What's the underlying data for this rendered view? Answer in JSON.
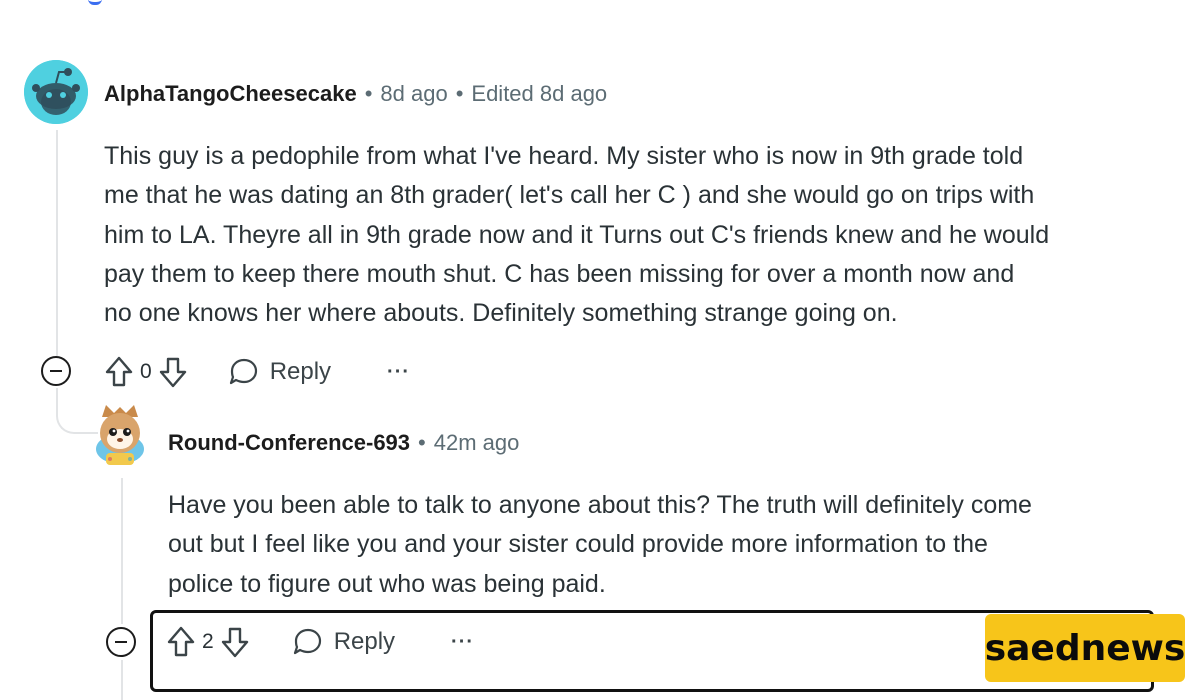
{
  "comment1": {
    "username": "AlphaTangoCheesecake",
    "time": "8d ago",
    "edited": "Edited 8d ago",
    "body_lines": [
      "This guy is a pedophile from what I've heard. My sister who is now in 9th grade told",
      "me that he was dating an 8th grader( let's call her C ) and she would go on trips with",
      "him to LA. Theyre all in 9th grade now and it Turns out C's friends knew and he would",
      "pay them to keep there mouth shut. C has been missing for over a month now and",
      "no one knows her where abouts. Definitely something strange going on."
    ],
    "votes": "0",
    "reply_label": "Reply",
    "more_label": "···"
  },
  "comment2": {
    "username": "Round-Conference-693",
    "time": "42m ago",
    "body_lines": [
      "Have you been able to talk to anyone about this? The truth will definitely come",
      "out but I feel like you and your sister could provide more information to the",
      "police to figure out who was being paid."
    ],
    "votes": "2",
    "reply_label": "Reply",
    "more_label": "···"
  },
  "watermark": {
    "text": "saednews"
  },
  "icons": {
    "upvote": "upvote-arrow-icon",
    "downvote": "downvote-arrow-icon",
    "reply": "speech-bubble-icon",
    "collapse": "minus-circle-icon"
  },
  "colors": {
    "avatar_bg": "#4fd0e0",
    "watermark_bg": "#f7c51a",
    "meta_text": "#5c6c74"
  }
}
